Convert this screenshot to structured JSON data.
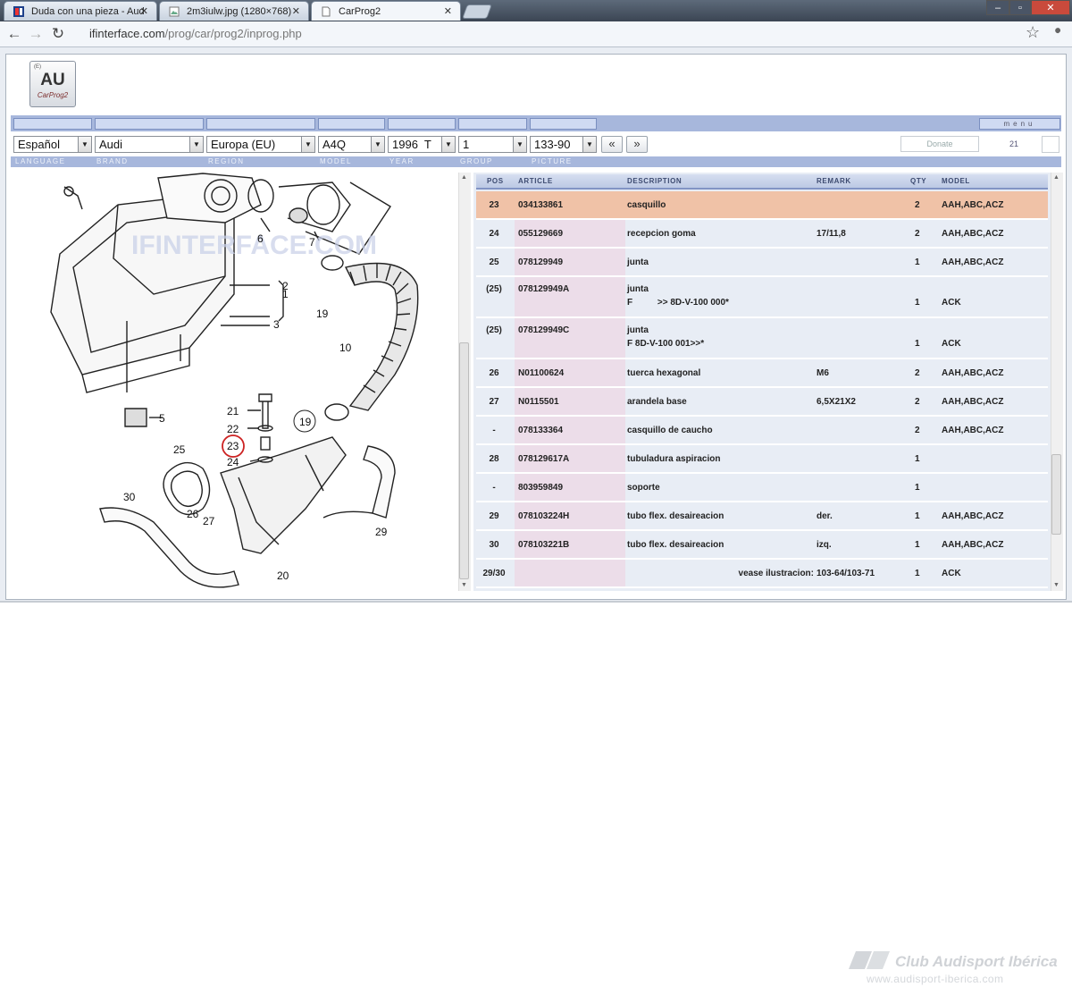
{
  "browser": {
    "tabs": [
      {
        "title": "Duda con una pieza - Aud"
      },
      {
        "title": "2m3iulw.jpg (1280×768)"
      },
      {
        "title": "CarProg2"
      }
    ],
    "url_host": "ifinterface.com",
    "url_path": "/prog/car/prog2/inprog.php"
  },
  "app": {
    "logo_main": "AU",
    "logo_sub": "CarProg2",
    "logo_tag": "(E)",
    "menu_label": "menu",
    "selectors": {
      "language": "Español",
      "brand": "Audi",
      "region": "Europa (EU)",
      "model": "A4Q",
      "year": "1996  T",
      "group": "1",
      "picture": "133-90"
    },
    "prev_label": "«",
    "next_label": "»",
    "donate_label": "Donate",
    "counter": "21",
    "labels": {
      "language": "LANGUAGE",
      "brand": "BRAND",
      "region": "REGION",
      "model": "MODEL",
      "year": "YEAR",
      "group": "GROUP",
      "picture": "PICTURE"
    }
  },
  "diagram": {
    "watermark": "IFINTERFACE.COM",
    "callouts": [
      "1",
      "2",
      "3",
      "5",
      "6",
      "7",
      "10",
      "19",
      "19",
      "20",
      "21",
      "22",
      "23",
      "24",
      "25",
      "26",
      "27",
      "29",
      "30"
    ],
    "highlighted_callout": "23"
  },
  "table": {
    "headers": {
      "pos": "POS",
      "article": "ARTICLE",
      "description": "DESCRIPTION",
      "remark": "REMARK",
      "qty": "QTY",
      "model": "MODEL"
    },
    "rows": [
      {
        "pos": "23",
        "article": "034133861",
        "desc": "casquillo",
        "desc2": "",
        "remark": "",
        "qty": "2",
        "model": "AAH,ABC,ACZ",
        "highlight": true
      },
      {
        "pos": "24",
        "article": "055129669",
        "desc": "recepcion goma",
        "desc2": "",
        "remark": "17/11,8",
        "qty": "2",
        "model": "AAH,ABC,ACZ"
      },
      {
        "pos": "25",
        "article": "078129949",
        "desc": "junta",
        "desc2": "",
        "remark": "",
        "qty": "1",
        "model": "AAH,ABC,ACZ"
      },
      {
        "pos": "(25)",
        "article": "078129949A",
        "desc": "junta",
        "desc2": "F          >> 8D-V-100 000*",
        "remark": "",
        "qty": "1",
        "model": "ACK"
      },
      {
        "pos": "(25)",
        "article": "078129949C",
        "desc": "junta",
        "desc2": "F 8D-V-100 001>>*",
        "remark": "",
        "qty": "1",
        "model": "ACK"
      },
      {
        "pos": "26",
        "article": "N01100624",
        "desc": "tuerca hexagonal",
        "desc2": "",
        "remark": "M6",
        "qty": "2",
        "model": "AAH,ABC,ACZ"
      },
      {
        "pos": "27",
        "article": "N0115501",
        "desc": "arandela base",
        "desc2": "",
        "remark": "6,5X21X2",
        "qty": "2",
        "model": "AAH,ABC,ACZ"
      },
      {
        "pos": "-",
        "article": "078133364",
        "desc": "casquillo de caucho",
        "desc2": "",
        "remark": "",
        "qty": "2",
        "model": "AAH,ABC,ACZ"
      },
      {
        "pos": "28",
        "article": "078129617A",
        "desc": "tubuladura aspiracion",
        "desc2": "",
        "remark": "",
        "qty": "1",
        "model": ""
      },
      {
        "pos": "-",
        "article": "803959849",
        "desc": "soporte",
        "desc2": "",
        "remark": "",
        "qty": "1",
        "model": ""
      },
      {
        "pos": "29",
        "article": "078103224H",
        "desc": "tubo flex. desaireacion",
        "desc2": "",
        "remark": "der.",
        "qty": "1",
        "model": "AAH,ABC,ACZ"
      },
      {
        "pos": "30",
        "article": "078103221B",
        "desc": "tubo flex. desaireacion",
        "desc2": "",
        "remark": "izq.",
        "qty": "1",
        "model": "AAH,ABC,ACZ"
      },
      {
        "pos": "29/30",
        "article": "",
        "desc": "",
        "desc2": "",
        "remark": "",
        "qty": "1",
        "model": "ACK",
        "note": "vease ilustracion:",
        "note_remark": "103-64/103-71"
      }
    ]
  },
  "watermark": {
    "line1": "Club Audisport Ibérica",
    "line2": "www.audisport-iberica.com"
  }
}
